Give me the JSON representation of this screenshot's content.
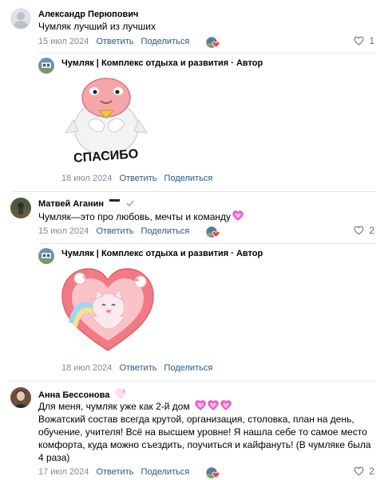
{
  "actions": {
    "reply": "Ответить",
    "share": "Поделиться"
  },
  "comments": [
    {
      "author": "Александр Перюпович",
      "text": "Чумляк лучший из лучших",
      "date": "15 июл 2024",
      "likes": "1"
    },
    {
      "author": "Чумляк | Комплекс отдыха и развития · Автор",
      "sticker_caption": "СПАСИБО",
      "date": "18 июл 2024"
    },
    {
      "author": "Матвей Аганин",
      "text": "Чумляк—это про любовь, мечты и команду",
      "date": "15 июл 2024",
      "likes": "2"
    },
    {
      "author": "Чумляк | Комплекс отдыха и развития · Автор",
      "date": "18 июл 2024"
    },
    {
      "author": "Анна Бессонова",
      "text_line1": "Для меня, чумляк уже как 2-й дом",
      "text_rest": "Вожатский состав всегда крутой, организация, столовка, план на день, обучение, учителя! Всё на высшем уровне! Я нашла себе то самое место комфорта, куда можно съездить, поучиться и кайфануть! (В чумляке была 4 раза)",
      "date": "17 июл 2024",
      "likes": "2"
    }
  ],
  "colors": {
    "link": "#2a5885",
    "muted": "#818c99",
    "heart": "#e64646",
    "pink_heart": "#f25ecf"
  },
  "icons": [
    "heart-outline-icon",
    "reaction-avatar-heart-icon",
    "verified-check-icon",
    "flag-icon",
    "pink-heart-emoji",
    "sparkle-heart-emoji"
  ]
}
